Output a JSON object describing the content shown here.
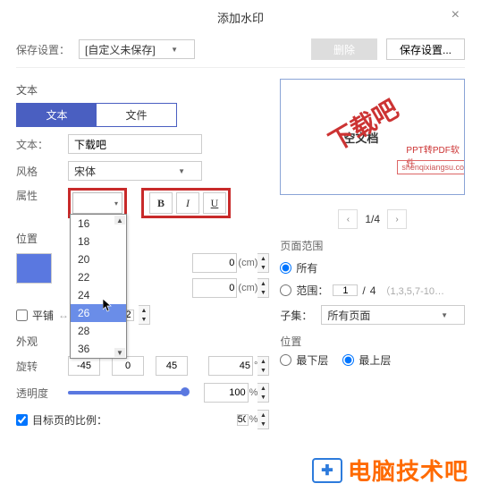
{
  "title": "添加水印",
  "save_settings": {
    "label": "保存设置：",
    "preset": "[自定义未保存]",
    "delete_btn": "删除",
    "save_btn": "保存设置..."
  },
  "text_section": {
    "header": "文本",
    "tab_text": "文本",
    "tab_file": "文件",
    "text_label": "文本：",
    "text_value": "下载吧",
    "style_label": "风格",
    "style_value": "宋体",
    "attr_label": "属性",
    "bold": "B",
    "italic": "I",
    "underline": "U",
    "size_options": [
      "16",
      "18",
      "20",
      "22",
      "24",
      "26",
      "28",
      "36"
    ],
    "size_selected": "26"
  },
  "position": {
    "header": "位置",
    "offset_x": "0",
    "offset_y": "0",
    "unit": "(cm)",
    "tile_label": "平铺",
    "tile_v1": "2",
    "tile_v2": "2"
  },
  "appearance": {
    "header": "外观",
    "rotate_label": "旋转",
    "rot_neg": "-45",
    "rot_zero": "0",
    "rot_pos": "45",
    "rot_value": "45",
    "rot_unit": "°",
    "opacity_label": "透明度",
    "opacity_value": "100",
    "opacity_unit": "%",
    "scale_label": "目标页的比例：",
    "scale_value": "50",
    "scale_unit": "%"
  },
  "preview": {
    "wm_text": "下载吧",
    "wm_center": "空文档",
    "wm_sub": "PPT转PDF软件",
    "wm_link": "shenqixiangsu.com"
  },
  "pager": {
    "current": "1",
    "total": "4",
    "display": "1/4"
  },
  "page_range": {
    "header": "页面范围",
    "all_label": "所有",
    "range_label": "范围：",
    "range_from": "1",
    "range_sep": "/",
    "range_to": "4",
    "range_hint": "（1,3,5,7-10…",
    "subset_label": "子集：",
    "subset_value": "所有页面"
  },
  "layer": {
    "header": "位置",
    "bottom": "最下层",
    "top": "最上层"
  },
  "footer": {
    "brand": "电脑技术吧"
  }
}
